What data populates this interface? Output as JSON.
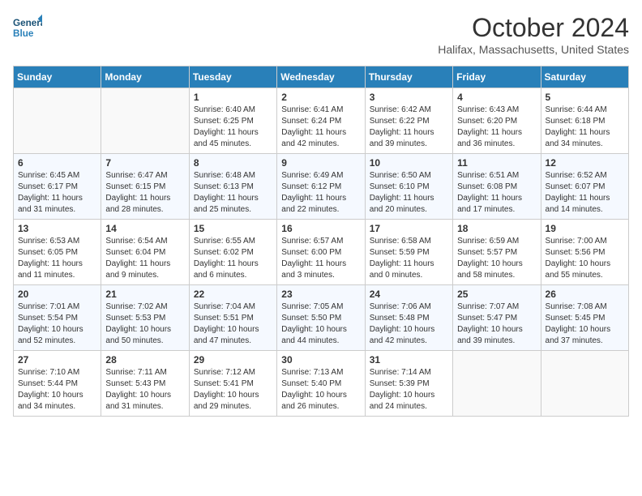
{
  "header": {
    "logo_general": "General",
    "logo_blue": "Blue",
    "title": "October 2024",
    "location": "Halifax, Massachusetts, United States"
  },
  "days_of_week": [
    "Sunday",
    "Monday",
    "Tuesday",
    "Wednesday",
    "Thursday",
    "Friday",
    "Saturday"
  ],
  "weeks": [
    [
      {
        "day": "",
        "info": ""
      },
      {
        "day": "",
        "info": ""
      },
      {
        "day": "1",
        "info": "Sunrise: 6:40 AM\nSunset: 6:25 PM\nDaylight: 11 hours and 45 minutes."
      },
      {
        "day": "2",
        "info": "Sunrise: 6:41 AM\nSunset: 6:24 PM\nDaylight: 11 hours and 42 minutes."
      },
      {
        "day": "3",
        "info": "Sunrise: 6:42 AM\nSunset: 6:22 PM\nDaylight: 11 hours and 39 minutes."
      },
      {
        "day": "4",
        "info": "Sunrise: 6:43 AM\nSunset: 6:20 PM\nDaylight: 11 hours and 36 minutes."
      },
      {
        "day": "5",
        "info": "Sunrise: 6:44 AM\nSunset: 6:18 PM\nDaylight: 11 hours and 34 minutes."
      }
    ],
    [
      {
        "day": "6",
        "info": "Sunrise: 6:45 AM\nSunset: 6:17 PM\nDaylight: 11 hours and 31 minutes."
      },
      {
        "day": "7",
        "info": "Sunrise: 6:47 AM\nSunset: 6:15 PM\nDaylight: 11 hours and 28 minutes."
      },
      {
        "day": "8",
        "info": "Sunrise: 6:48 AM\nSunset: 6:13 PM\nDaylight: 11 hours and 25 minutes."
      },
      {
        "day": "9",
        "info": "Sunrise: 6:49 AM\nSunset: 6:12 PM\nDaylight: 11 hours and 22 minutes."
      },
      {
        "day": "10",
        "info": "Sunrise: 6:50 AM\nSunset: 6:10 PM\nDaylight: 11 hours and 20 minutes."
      },
      {
        "day": "11",
        "info": "Sunrise: 6:51 AM\nSunset: 6:08 PM\nDaylight: 11 hours and 17 minutes."
      },
      {
        "day": "12",
        "info": "Sunrise: 6:52 AM\nSunset: 6:07 PM\nDaylight: 11 hours and 14 minutes."
      }
    ],
    [
      {
        "day": "13",
        "info": "Sunrise: 6:53 AM\nSunset: 6:05 PM\nDaylight: 11 hours and 11 minutes."
      },
      {
        "day": "14",
        "info": "Sunrise: 6:54 AM\nSunset: 6:04 PM\nDaylight: 11 hours and 9 minutes."
      },
      {
        "day": "15",
        "info": "Sunrise: 6:55 AM\nSunset: 6:02 PM\nDaylight: 11 hours and 6 minutes."
      },
      {
        "day": "16",
        "info": "Sunrise: 6:57 AM\nSunset: 6:00 PM\nDaylight: 11 hours and 3 minutes."
      },
      {
        "day": "17",
        "info": "Sunrise: 6:58 AM\nSunset: 5:59 PM\nDaylight: 11 hours and 0 minutes."
      },
      {
        "day": "18",
        "info": "Sunrise: 6:59 AM\nSunset: 5:57 PM\nDaylight: 10 hours and 58 minutes."
      },
      {
        "day": "19",
        "info": "Sunrise: 7:00 AM\nSunset: 5:56 PM\nDaylight: 10 hours and 55 minutes."
      }
    ],
    [
      {
        "day": "20",
        "info": "Sunrise: 7:01 AM\nSunset: 5:54 PM\nDaylight: 10 hours and 52 minutes."
      },
      {
        "day": "21",
        "info": "Sunrise: 7:02 AM\nSunset: 5:53 PM\nDaylight: 10 hours and 50 minutes."
      },
      {
        "day": "22",
        "info": "Sunrise: 7:04 AM\nSunset: 5:51 PM\nDaylight: 10 hours and 47 minutes."
      },
      {
        "day": "23",
        "info": "Sunrise: 7:05 AM\nSunset: 5:50 PM\nDaylight: 10 hours and 44 minutes."
      },
      {
        "day": "24",
        "info": "Sunrise: 7:06 AM\nSunset: 5:48 PM\nDaylight: 10 hours and 42 minutes."
      },
      {
        "day": "25",
        "info": "Sunrise: 7:07 AM\nSunset: 5:47 PM\nDaylight: 10 hours and 39 minutes."
      },
      {
        "day": "26",
        "info": "Sunrise: 7:08 AM\nSunset: 5:45 PM\nDaylight: 10 hours and 37 minutes."
      }
    ],
    [
      {
        "day": "27",
        "info": "Sunrise: 7:10 AM\nSunset: 5:44 PM\nDaylight: 10 hours and 34 minutes."
      },
      {
        "day": "28",
        "info": "Sunrise: 7:11 AM\nSunset: 5:43 PM\nDaylight: 10 hours and 31 minutes."
      },
      {
        "day": "29",
        "info": "Sunrise: 7:12 AM\nSunset: 5:41 PM\nDaylight: 10 hours and 29 minutes."
      },
      {
        "day": "30",
        "info": "Sunrise: 7:13 AM\nSunset: 5:40 PM\nDaylight: 10 hours and 26 minutes."
      },
      {
        "day": "31",
        "info": "Sunrise: 7:14 AM\nSunset: 5:39 PM\nDaylight: 10 hours and 24 minutes."
      },
      {
        "day": "",
        "info": ""
      },
      {
        "day": "",
        "info": ""
      }
    ]
  ]
}
